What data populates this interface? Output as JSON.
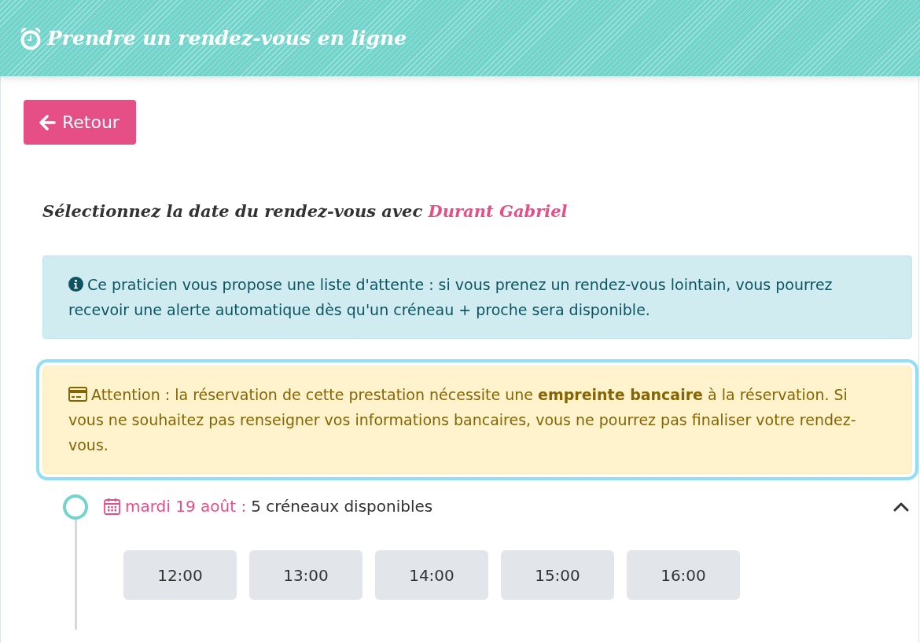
{
  "header": {
    "title": "Prendre un rendez-vous en ligne"
  },
  "back_button": {
    "label": "Retour"
  },
  "heading": {
    "text": "Sélectionnez la date du rendez-vous avec ",
    "practitioner": "Durant Gabriel"
  },
  "alerts": [
    {
      "kind": "info",
      "highlighted": false,
      "text": "Ce praticien vous propose une liste d'attente : si vous prenez un rendez-vous lointain, vous pourrez recevoir une alerte automatique dès qu'un créneau + proche sera disponible."
    },
    {
      "kind": "warning",
      "highlighted": true,
      "text": "Attention : la réservation de cette prestation nécessite une **empreinte bancaire** à la réservation. Si vous ne souhaitez pas renseigner vos informations bancaires, vous ne pourrez pas finaliser votre rendez-vous."
    }
  ],
  "days": [
    {
      "date": "mardi 19 août :",
      "summary": "5 créneaux disponibles",
      "expanded": true,
      "slots": [
        "12:00",
        "13:00",
        "14:00",
        "15:00",
        "16:00"
      ]
    }
  ]
}
